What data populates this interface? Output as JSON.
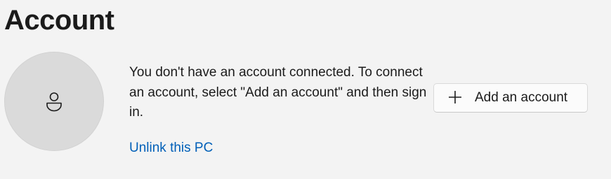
{
  "page": {
    "title": "Account"
  },
  "account": {
    "avatar_icon": "person-icon",
    "message": "You don't have an account connected. To connect an account, select \"Add an account\" and then sign in.",
    "unlink_label": "Unlink this PC",
    "add_button": {
      "label": "Add an account",
      "icon": "plus-icon"
    }
  },
  "colors": {
    "background": "#f3f3f3",
    "avatar": "#dadada",
    "link": "#005fb8",
    "button_background": "#fbfbfb",
    "text": "#1b1b1b"
  }
}
